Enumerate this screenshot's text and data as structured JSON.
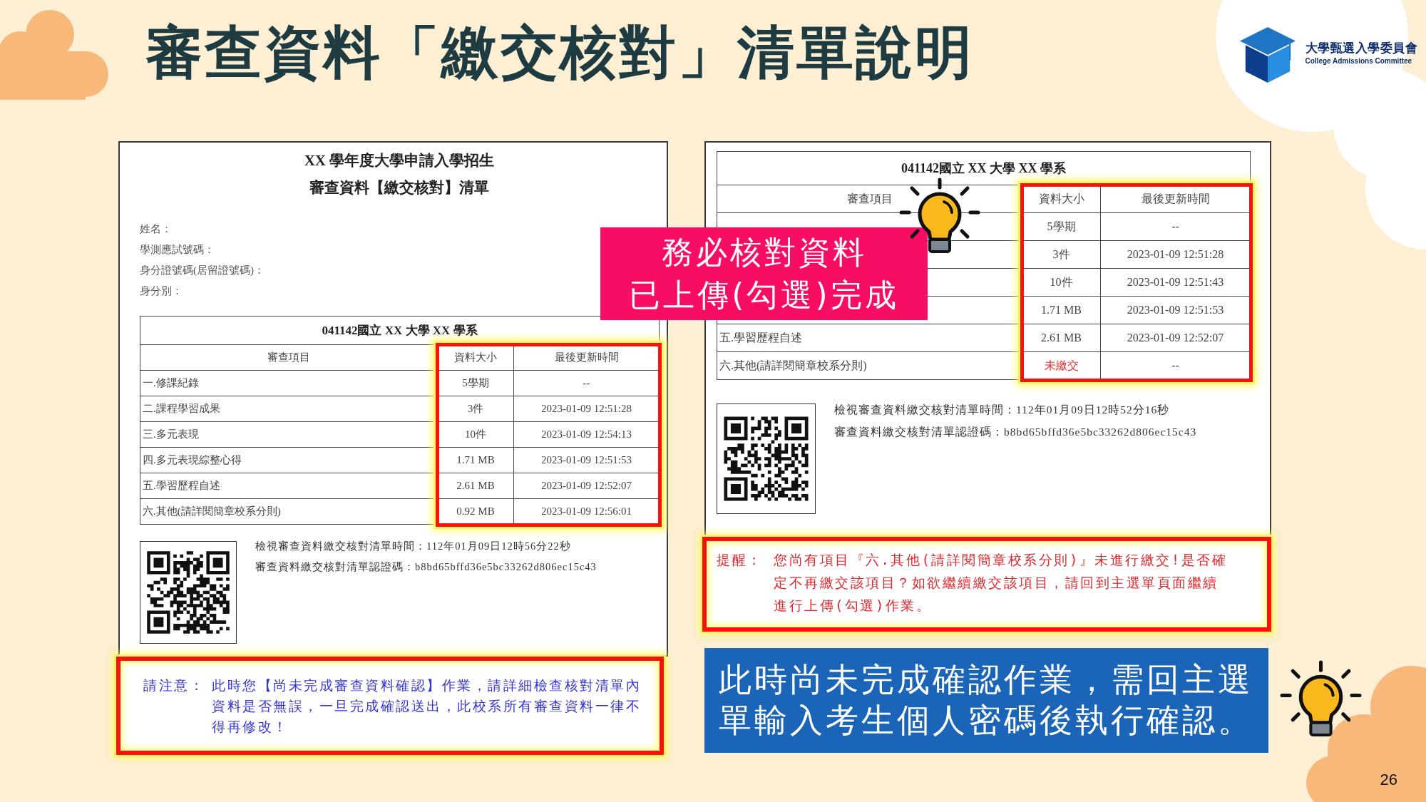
{
  "slide": {
    "title": "審查資料「繳交核對」清單說明",
    "page_number": "26"
  },
  "logo": {
    "name": "大學甄選入學委員會",
    "english_name": "College Admissions Committee"
  },
  "left_document": {
    "title": "XX 學年度大學申請入學招生",
    "subtitle": "審查資料【繳交核對】清單",
    "fields": [
      "姓名：",
      "學測應試號碼：",
      "身分證號碼(居留證號碼)：",
      "身分別："
    ],
    "table": {
      "title": "041142國立 XX 大學 XX 學系",
      "columns": [
        {
          "label": "審查項目",
          "highlighted": false
        },
        {
          "label": "資料大小",
          "highlighted": true
        },
        {
          "label": "最後更新時間",
          "highlighted": true
        }
      ],
      "rows": [
        {
          "item": "一.修課紀錄",
          "size": "5學期",
          "updated": "--",
          "submitted": true
        },
        {
          "item": "二.課程學習成果",
          "size": "3件",
          "updated": "2023-01-09 12:51:28",
          "submitted": true
        },
        {
          "item": "三.多元表現",
          "size": "10件",
          "updated": "2023-01-09 12:54:13",
          "submitted": true
        },
        {
          "item": "四.多元表現綜整心得",
          "size": "1.71 MB",
          "updated": "2023-01-09 12:51:53",
          "submitted": true
        },
        {
          "item": "五.學習歷程自述",
          "size": "2.61 MB",
          "updated": "2023-01-09 12:52:07",
          "submitted": true
        },
        {
          "item": "六.其他(請詳閱簡章校系分則)",
          "size": "0.92 MB",
          "updated": "2023-01-09 12:56:01",
          "submitted": true
        }
      ]
    },
    "verification": [
      "檢視審查資料繳交核對清單時間：112年01月09日12時56分22秒",
      "審查資料繳交核對清單認證碼：b8bd65bffd36e5bc33262d806ec15c43"
    ],
    "notice": {
      "kind": "caution",
      "label": "請注意：",
      "text": "此時您【尚未完成審查資料確認】作業，請詳細檢查核對清單內資料是否無誤，一旦完成確認送出，此校系所有審查資料一律不得再修改！"
    }
  },
  "right_document": {
    "table": {
      "title": "041142國立 XX 大學 XX 學系",
      "columns": [
        {
          "label": "審查項目",
          "highlighted": false
        },
        {
          "label": "資料大小",
          "highlighted": true
        },
        {
          "label": "最後更新時間",
          "highlighted": true
        }
      ],
      "rows": [
        {
          "size": "5學期",
          "updated": "--",
          "submitted": true
        },
        {
          "size": "3件",
          "updated": "2023-01-09 12:51:28",
          "submitted": true
        },
        {
          "size": "10件",
          "updated": "2023-01-09 12:51:43",
          "submitted": true
        },
        {
          "size": "1.71 MB",
          "updated": "2023-01-09 12:51:53",
          "submitted": true
        },
        {
          "item": "五.學習歷程自述",
          "size": "2.61 MB",
          "updated": "2023-01-09 12:52:07",
          "submitted": true
        },
        {
          "item": "六.其他(請詳閱簡章校系分則)",
          "size": "未繳交",
          "updated": "--",
          "submitted": false
        }
      ]
    },
    "verification": [
      "檢視審查資料繳交核對清單時間：112年01月09日12時52分16秒",
      "審查資料繳交核對清單認證碼：b8bd65bffd36e5bc33262d806ec15c43"
    ],
    "notice": {
      "kind": "alert",
      "label": "提醒：",
      "text": "您尚有項目『六.其他(請詳閱簡章校系分則)』未進行繳交!是否確定不再繳交該項目？如欲繼續繳交該項目，請回到主選單頁面繼續進行上傳(勾選)作業。"
    }
  },
  "callout": {
    "lines": [
      "務必核對資料",
      "已上傳(勾選)完成"
    ]
  },
  "info_banner": {
    "text": "此時尚未完成確認作業，需回主選單輸入考生個人密碼後執行確認。"
  }
}
